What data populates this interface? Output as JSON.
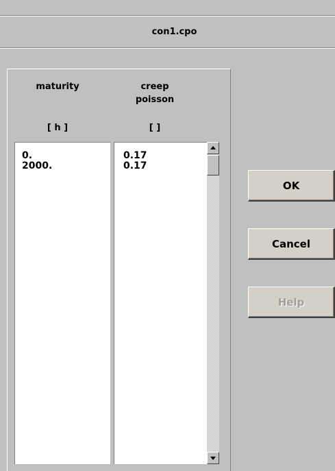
{
  "window": {
    "title": "con1.cpo"
  },
  "table": {
    "columns": [
      {
        "header": [
          "maturity"
        ],
        "unit": "[ h ]"
      },
      {
        "header": [
          "creep",
          "poisson"
        ],
        "unit": "[ ]"
      }
    ],
    "rows": [
      [
        "0.",
        "0.17"
      ],
      [
        "2000.",
        "0.17"
      ]
    ]
  },
  "buttons": {
    "ok": "OK",
    "cancel": "Cancel",
    "help": "Help"
  },
  "scrollbar": {
    "up_icon": "arrow-up-icon",
    "down_icon": "arrow-down-icon"
  }
}
